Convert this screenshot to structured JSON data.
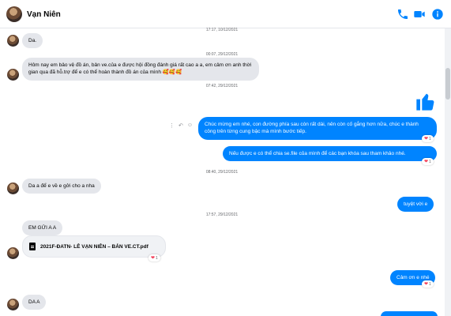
{
  "header": {
    "contact_name": "Vạn Niên"
  },
  "colors": {
    "accent": "#0084ff",
    "incoming_bubble": "#e4e6eb",
    "heart": "#f33e58"
  },
  "icons": [
    "phone-icon",
    "video-icon",
    "info-icon",
    "thumbs-up-icon",
    "heart-icon",
    "file-icon"
  ],
  "timestamps": [
    "17:17, 10/12/2021",
    "00:07, 29/12/2021",
    "07:42, 29/12/2021",
    "08:40, 29/12/2021",
    "17:57, 29/12/2021"
  ],
  "messages": {
    "m1": "Da.",
    "m2": "Hôm nay em bảo vệ đồ án, bản ve.của e được hội đồng đánh giá rất cao a a, em cảm ơn anh thời gian qua đã hỗ.trợ để e có thể hoàn thành đồ án của mình 🥰🥰🥰",
    "m3": "Chúc mừng em nhé, con đường phía sau còn rất dài, nên còn cố gắng hơn nữa, chúc e thành công trên từng cung bậc mà mình bước tiếp.",
    "m4": "Nếu được e có thể chia se.file của mình để các bạn khóa sau tham khảo nhé.",
    "m5": "Da a để e về e gởi cho a nha",
    "m6": "tuyệt vời e",
    "m7": "EM GỬI A A",
    "m8": "2021F-ĐATN- LÊ VẠN NIÊN – BẢN VE.CT.pdf",
    "m9": "Cảm ơn e nhé",
    "m10": "DA A"
  },
  "reactions": {
    "r1": "1",
    "r2": "1",
    "r3": "1",
    "r4": "1"
  }
}
